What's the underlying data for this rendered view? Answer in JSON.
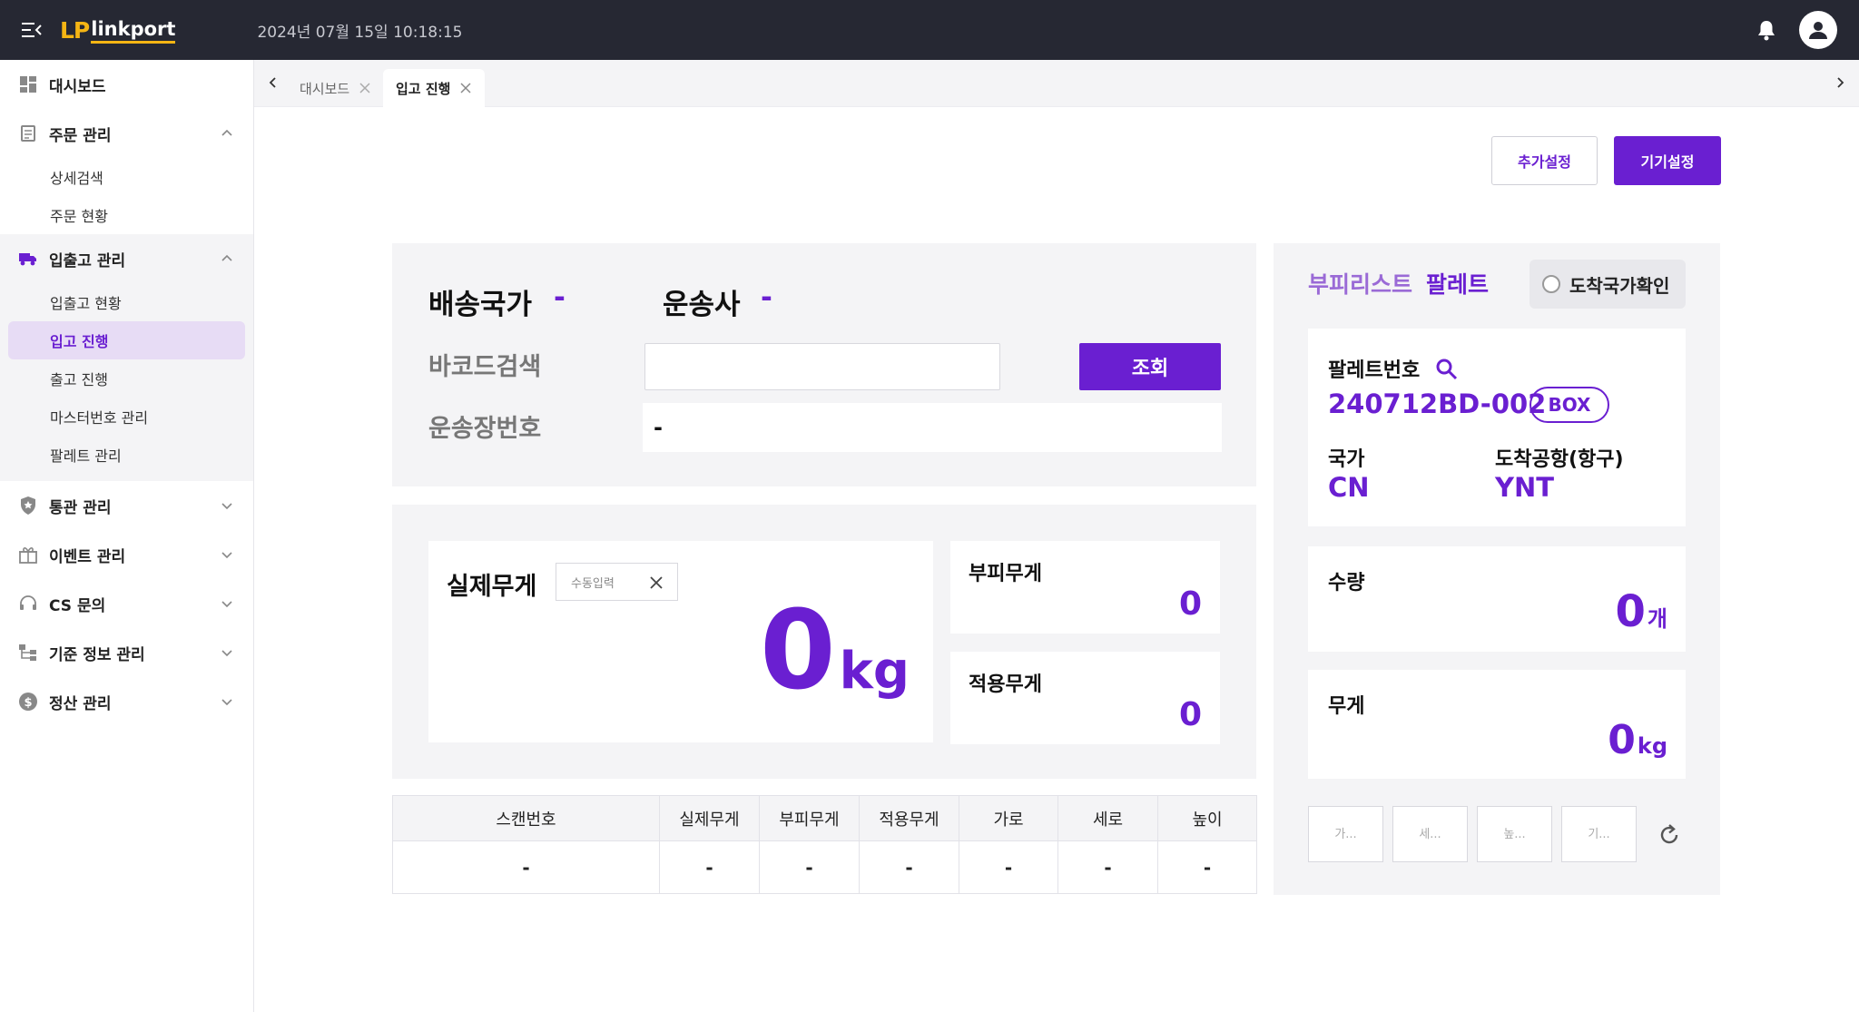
{
  "header": {
    "logo_mark": "LP",
    "logo_text": "linkport",
    "datetime": "2024년 07월 15일 10:18:15"
  },
  "sidebar": {
    "dashboard": "대시보드",
    "order": {
      "label": "주문 관리",
      "items": [
        "상세검색",
        "주문 현황"
      ]
    },
    "inout": {
      "label": "입출고 관리",
      "items": [
        "입출고 현황",
        "입고 진행",
        "출고 진행",
        "마스터번호 관리",
        "팔레트 관리"
      ]
    },
    "customs": "통관 관리",
    "event": "이벤트 관리",
    "cs": "CS 문의",
    "base_info": "기준 정보 관리",
    "settle": "정산 관리"
  },
  "tabs": [
    {
      "label": "대시보드"
    },
    {
      "label": "입고 진행"
    }
  ],
  "buttons": {
    "extra_settings": "추가설정",
    "device_settings": "기기설정"
  },
  "search": {
    "ship_country_label": "배송국가",
    "ship_country_value": "-",
    "carrier_label": "운송사",
    "carrier_value": "-",
    "barcode_label": "바코드검색",
    "barcode_value": "",
    "search_button": "조회",
    "waybill_label": "운송장번호",
    "waybill_value": "-"
  },
  "weight": {
    "actual_label": "실제무게",
    "manual_label": "수동입력",
    "actual_value": "0",
    "actual_unit": "kg",
    "volume_label": "부피무게",
    "volume_value": "0",
    "applied_label": "적용무게",
    "applied_value": "0"
  },
  "table": {
    "headers": [
      "스캔번호",
      "실제무게",
      "부피무게",
      "적용무게",
      "가로",
      "세로",
      "높이"
    ],
    "rows": [
      [
        "-",
        "-",
        "-",
        "-",
        "-",
        "-",
        "-"
      ]
    ]
  },
  "pallet": {
    "title_a": "부피리스트",
    "title_b": "팔레트",
    "arrive_check": "도착국가확인",
    "pallet_no_label": "팔레트번호",
    "pallet_no": "240712BD-002",
    "pallet_type": "BOX",
    "country_label": "국가",
    "country": "CN",
    "airport_label": "도착공항(항구)",
    "airport": "YNT",
    "qty_label": "수량",
    "qty_value": "0",
    "qty_unit": "개",
    "weight_label": "무게",
    "weight_value": "0",
    "weight_unit": "kg",
    "dim_placeholders": [
      "가...",
      "세...",
      "높...",
      "기..."
    ]
  },
  "colors": {
    "accent": "#6a1fd1",
    "header_bg": "#262833",
    "logo": "#f5b514",
    "panel_bg": "#f4f4f6"
  }
}
